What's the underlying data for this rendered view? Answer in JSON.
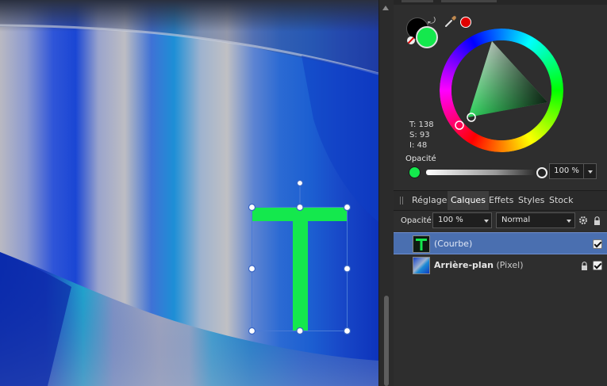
{
  "colors": {
    "accent": "#14e84d",
    "selection_blue": "#4a6fb0",
    "picked_red": "#e00000"
  },
  "color_panel": {
    "hsl": {
      "t": "T: 138",
      "s": "S: 93",
      "i": "I: 48"
    },
    "opacity_label": "Opacité",
    "opacity_value": "100 %",
    "opacity_fraction": 1.0
  },
  "tabs": [
    {
      "label": "Réglage",
      "active": false
    },
    {
      "label": "Calques",
      "active": true
    },
    {
      "label": "Effets",
      "active": false
    },
    {
      "label": "Styles",
      "active": false
    },
    {
      "label": "Stock",
      "active": false
    }
  ],
  "layers_panel": {
    "opacity_label": "Opacité:",
    "opacity_value": "100 %",
    "blend_mode": "Normal",
    "layers": [
      {
        "name": "",
        "type": "(Courbe)",
        "selected": true,
        "visible": true,
        "locked": false,
        "thumb_icon": "letter-t-icon"
      },
      {
        "name": "Arrière-plan",
        "type": "(Pixel)",
        "selected": false,
        "visible": true,
        "locked": true,
        "thumb_icon": "image-icon"
      }
    ]
  }
}
